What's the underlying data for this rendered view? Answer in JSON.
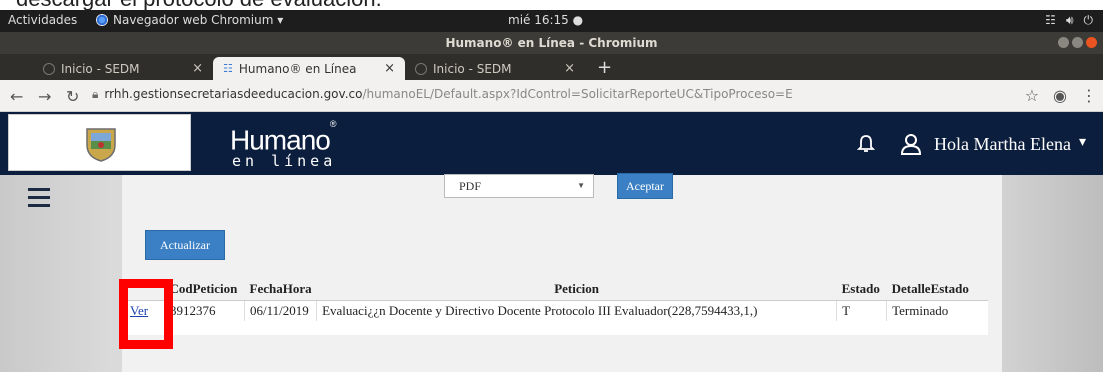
{
  "caption": "descargar el protocolo de evaluación.",
  "system_bar": {
    "activities": "Actividades",
    "app_name": "Navegador web Chromium ▾",
    "clock": "mié 16:15 ●"
  },
  "window_title": "Humano® en Línea - Chromium",
  "tabs": [
    {
      "label": "Inicio - SEDM"
    },
    {
      "label": "Humano® en Línea"
    },
    {
      "label": "Inicio - SEDM"
    }
  ],
  "address": {
    "host": "rrhh.gestionsecretariasdeeducacion.gov.co",
    "path": "/humanoEL/Default.aspx?IdControl=SolicitarReporteUC&TipoProceso=E"
  },
  "header": {
    "logo_main": "Humano",
    "logo_mark": "®",
    "logo_sub": "en línea",
    "greeting": "Hola Martha Elena"
  },
  "form": {
    "format_selected": "PDF",
    "accept_label": "Aceptar",
    "refresh_label": "Actualizar"
  },
  "table": {
    "columns": [
      "",
      "CodPeticion",
      "FechaHora",
      "Peticion",
      "Estado",
      "DetalleEstado"
    ],
    "rows": [
      {
        "action": "Ver",
        "cod": "3912376",
        "fecha": "06/11/2019",
        "peticion": "Evaluaci¿¿n Docente y Directivo Docente Protocolo III Evaluador(228,7594433,1,)",
        "estado": "T",
        "detalle": "Terminado"
      }
    ]
  },
  "colors": {
    "header_bg": "#0c1e3d",
    "button_blue": "#3b7fc4",
    "highlight_red": "#ff0000"
  }
}
